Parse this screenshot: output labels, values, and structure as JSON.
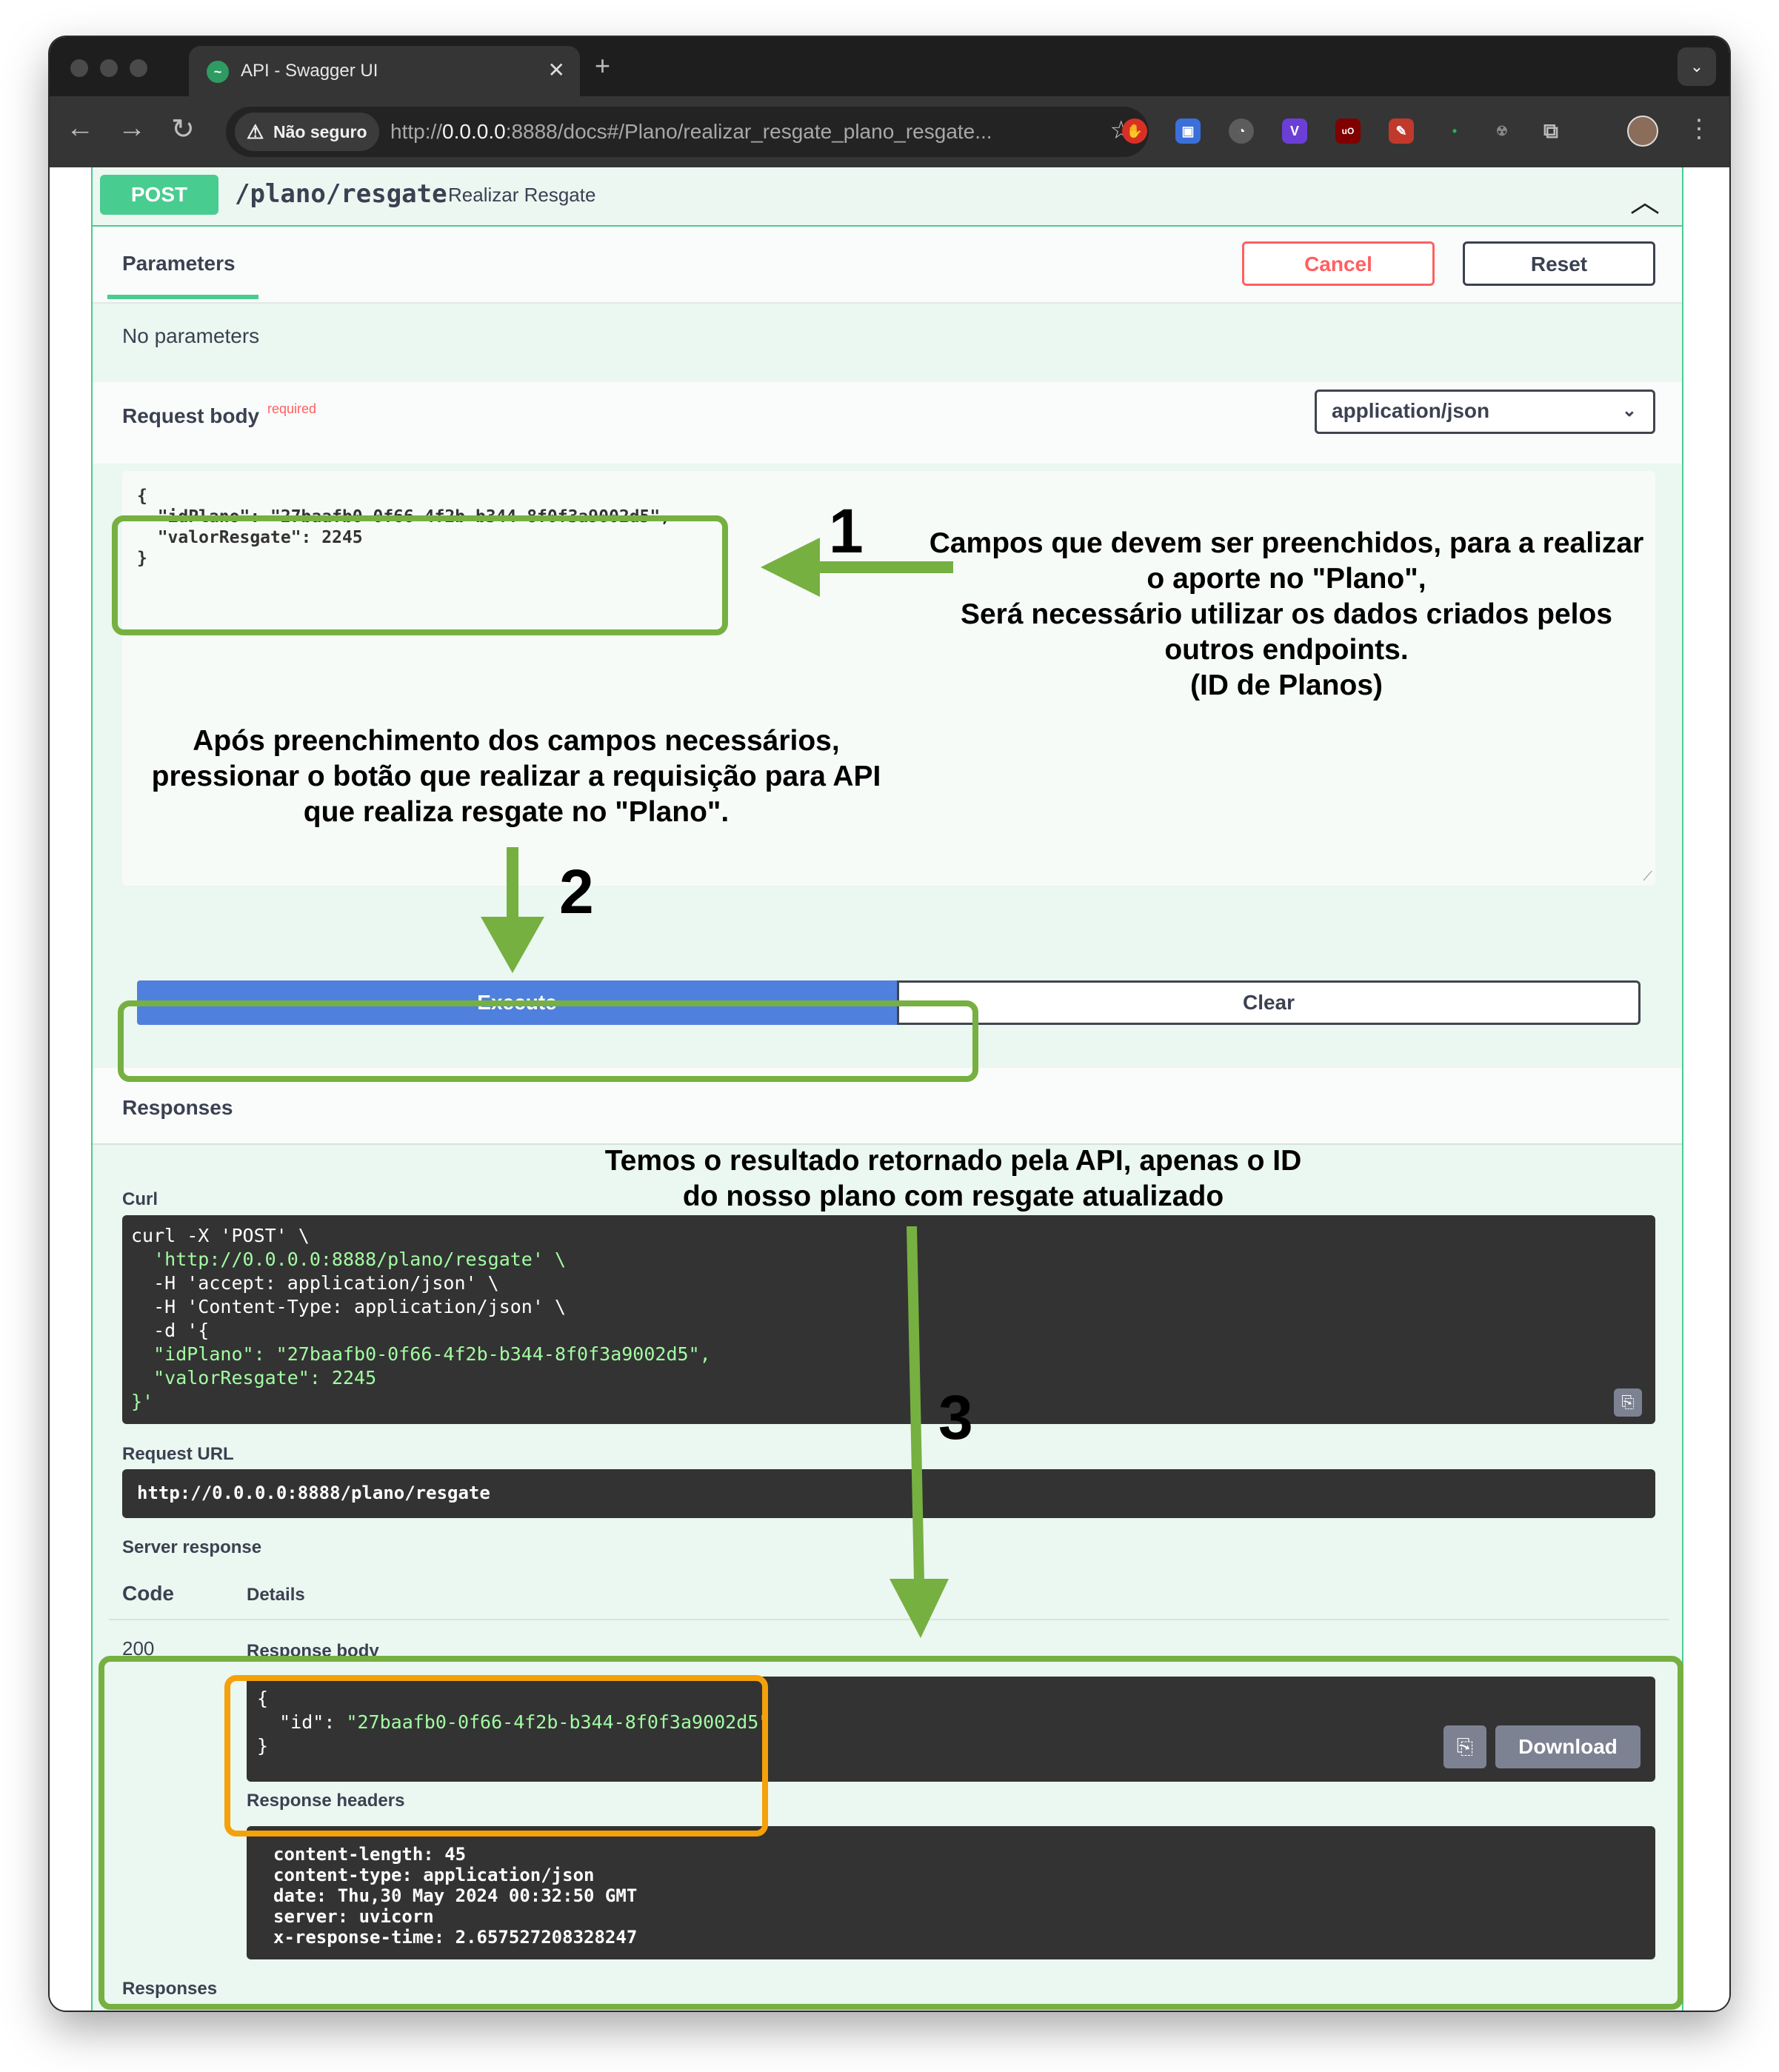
{
  "browser": {
    "tab_title": "API - Swagger UI",
    "security_label": "Não seguro",
    "url_prefix": "http://",
    "url_host": "0.0.0.0",
    "url_rest": ":8888/docs#/Plano/realizar_resgate_plano_resgate..."
  },
  "operation": {
    "method": "POST",
    "path": "/plano/resgate",
    "summary": "Realizar Resgate"
  },
  "parameters": {
    "tab_label": "Parameters",
    "cancel_label": "Cancel",
    "reset_label": "Reset",
    "no_params": "No parameters"
  },
  "request_body": {
    "label": "Request body",
    "required": "required",
    "content_type": "application/json",
    "json_lines": [
      "{",
      "  \"idPlano\": \"27baafb0-0f66-4f2b-b344-8f0f3a9002d5\",",
      "  \"valorResgate\": 2245",
      "}"
    ]
  },
  "actions": {
    "execute_label": "Execute",
    "clear_label": "Clear"
  },
  "responses": {
    "title": "Responses",
    "curl_label": "Curl",
    "curl_lines": [
      "curl -X 'POST' \\",
      "  'http://0.0.0.0:8888/plano/resgate' \\",
      "  -H 'accept: application/json' \\",
      "  -H 'Content-Type: application/json' \\",
      "  -d '{",
      "  \"idPlano\": \"27baafb0-0f66-4f2b-b344-8f0f3a9002d5\",",
      "  \"valorResgate\": 2245",
      "}'"
    ],
    "request_url_label": "Request URL",
    "request_url": "http://0.0.0.0:8888/plano/resgate",
    "server_response_label": "Server response",
    "code_col": "Code",
    "details_col": "Details",
    "code": "200",
    "response_body_label": "Response body",
    "body_open": "{",
    "body_key": "\"id\"",
    "body_sep": ": ",
    "body_value": "\"27baafb0-0f66-4f2b-b344-8f0f3a9002d5\"",
    "body_close": "}",
    "download_label": "Download",
    "response_headers_label": "Response headers",
    "headers": [
      "content-length: 45",
      "content-type: application/json",
      "date: Thu,30 May 2024 00:32:50 GMT",
      "server: uvicorn",
      "x-response-time: 2.657527208328247"
    ],
    "bottom_label": "Responses"
  },
  "annotations": {
    "step1_number": "1",
    "step1_lines": [
      "Campos que devem ser preenchidos, para a realizar",
      "o aporte no \"Plano\",",
      "Será necessário utilizar os dados criados pelos",
      "outros endpoints.",
      "(ID de Planos)"
    ],
    "step2_number": "2",
    "step2_lines": [
      "Após preenchimento dos campos necessários,",
      "pressionar o botão que realizar a requisição para API",
      "que realiza resgate no \"Plano\"."
    ],
    "step3_number": "3",
    "step3_lines": [
      "Temos o resultado retornado pela API, apenas o ID",
      "do nosso plano com resgate atualizado"
    ],
    "highlight_green": "#76b041",
    "highlight_orange": "#f5a10a"
  },
  "colors": {
    "post_green": "#49cc90",
    "execute_blue": "#4f80dd",
    "cancel_red": "#ff6060",
    "code_bg": "#333333",
    "code_string": "#a2fca2"
  }
}
